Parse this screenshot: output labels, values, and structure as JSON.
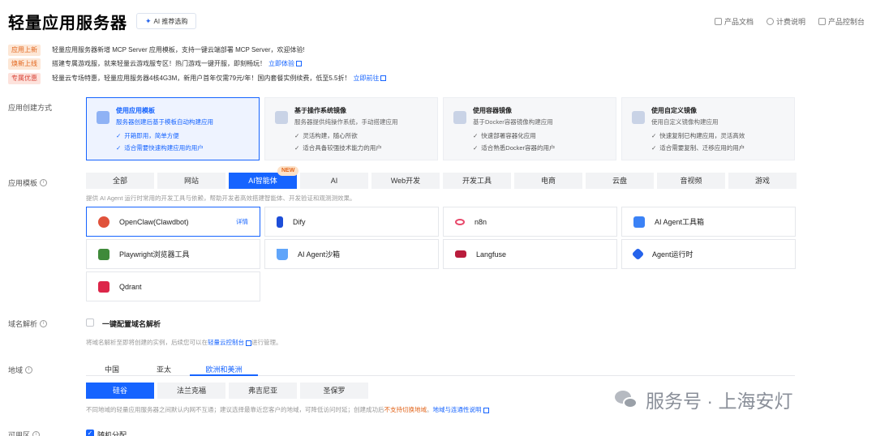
{
  "header": {
    "title": "轻量应用服务器",
    "ai_badge": "AI 推荐选购",
    "links": [
      "产品文档",
      "计费说明",
      "产品控制台"
    ]
  },
  "notices": [
    {
      "tag": "应用上新",
      "text": "轻量应用服务器新增 MCP Server 应用模板，支持一键云端部署 MCP Server，欢迎体验!",
      "link": ""
    },
    {
      "tag": "焕新上线",
      "text": "搭建专属游戏服，就来轻量云游戏服专区！热门游戏一键开服，即刻畅玩！",
      "link": "立即体验"
    },
    {
      "tag": "专属优惠",
      "text": "轻量云专场特惠，轻量应用服务器4核4G3M，新用户首年仅需79元/年！国内套餐实例续费，低至5.5折！",
      "link": "立即前往"
    }
  ],
  "labels": {
    "creation_method": "应用创建方式",
    "template": "应用模板",
    "domain": "域名解析",
    "region": "地域",
    "availability": "可用区"
  },
  "methods": [
    {
      "title": "使用应用模板",
      "desc": "服务器创建后基于模板自动构建应用",
      "bullets": [
        "开箱即用，简单方便",
        "适合需要快速构建应用的用户"
      ]
    },
    {
      "title": "基于操作系统镜像",
      "desc": "服务器提供纯操作系统，手动搭建应用",
      "bullets": [
        "灵活构建，随心所欲",
        "适合具备较强技术能力的用户"
      ]
    },
    {
      "title": "使用容器镜像",
      "desc": "基于Docker容器镜像构建应用",
      "bullets": [
        "快速部署容器化应用",
        "适合熟悉Docker容器的用户"
      ]
    },
    {
      "title": "使用自定义镜像",
      "desc": "使用自定义镜像构建应用",
      "bullets": [
        "快速复制已构建应用，灵活高效",
        "适合需要复制、迁移应用的用户"
      ]
    }
  ],
  "categories": [
    "全部",
    "网站",
    "AI智能体",
    "AI",
    "Web开发",
    "开发工具",
    "电商",
    "云盘",
    "音视频",
    "游戏"
  ],
  "new_badge": "NEW",
  "category_desc": "提供 AI Agent 运行时常用的开发工具与依赖，帮助开发者高效搭建智能体、开发验证和观测测效果。",
  "apps": [
    {
      "name": "OpenClaw(Clawdbot)",
      "detail": "详情"
    },
    {
      "name": "Dify"
    },
    {
      "name": "n8n"
    },
    {
      "name": "AI Agent工具箱"
    },
    {
      "name": "Playwright浏览器工具"
    },
    {
      "name": "AI Agent沙箱"
    },
    {
      "name": "Langfuse"
    },
    {
      "name": "Agent运行时"
    },
    {
      "name": "Qdrant"
    }
  ],
  "domain": {
    "checkbox_label": "一键配置域名解析",
    "note_prefix": "将域名解析至即将创建的实例，后续您可以在",
    "note_link": "轻量云控制台",
    "note_suffix": "进行管理。"
  },
  "region_tabs": [
    "中国",
    "亚太",
    "欧洲和美洲"
  ],
  "cities": [
    "硅谷",
    "法兰克福",
    "弗吉尼亚",
    "圣保罗"
  ],
  "region_note": {
    "text": "不同地域的轻量应用服务器之间默认内网不互通；建议选择最靠近您客户的地域，可降低访问时延；创建成功后",
    "warn": "不支持切换地域",
    "sep": "。",
    "link": "地域与连通性说明"
  },
  "availability": {
    "label": "随机分配"
  },
  "watermark": {
    "text": "服务号 · 上海安灯"
  }
}
